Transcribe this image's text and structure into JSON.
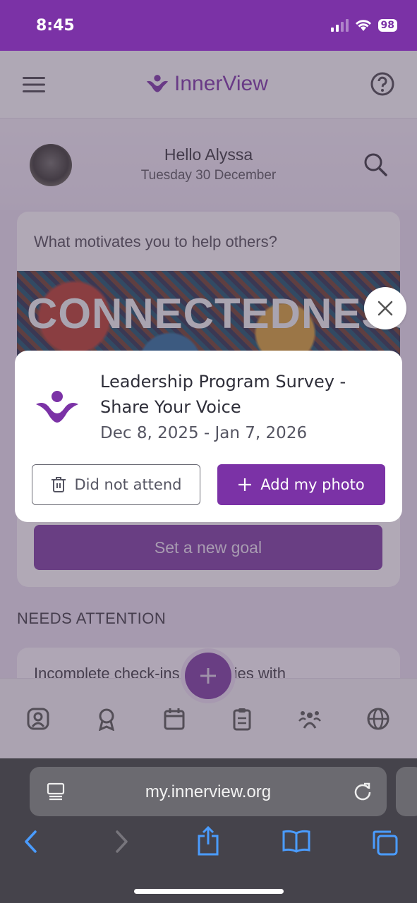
{
  "status_bar": {
    "time": "8:45",
    "battery": "98"
  },
  "app": {
    "brand": "InnerView",
    "greeting": "Hello Alyssa",
    "date": "Tuesday 30 December",
    "card_question": "What motivates you to help others?",
    "card_image_text": "CONNECTEDNESS",
    "goal_button": "Set a new goal",
    "section_title": "NEEDS ATTENTION",
    "card2_text": "Incomplete check-ins · Activities with"
  },
  "modal": {
    "title": "Leadership Program Survey - Share Your Voice",
    "dates": "Dec 8, 2025 - Jan 7, 2026",
    "did_not_attend": "Did not attend",
    "add_photo": "Add my photo"
  },
  "browser": {
    "url": "my.innerview.org"
  },
  "colors": {
    "brand": "#7b32a6",
    "button_border": "#6c6c76"
  }
}
